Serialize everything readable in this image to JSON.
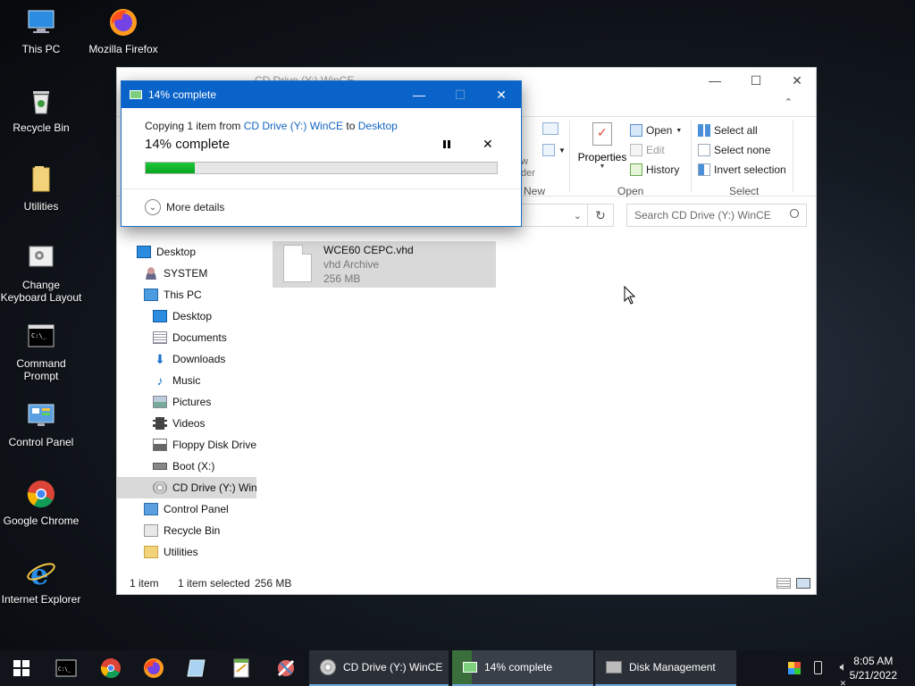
{
  "desktop": {
    "icons": [
      {
        "label": "This PC"
      },
      {
        "label": "Mozilla Firefox"
      },
      {
        "label": "Recycle Bin"
      },
      {
        "label": "Utilities"
      },
      {
        "label": "Change Keyboard Layout"
      },
      {
        "label": "Command Prompt"
      },
      {
        "label": "Control Panel"
      },
      {
        "label": "Google Chrome"
      },
      {
        "label": "Internet Explorer"
      }
    ]
  },
  "explorer": {
    "title": "CD Drive (Y:) WinCE",
    "ribbon": {
      "new_group_partial": "w\nder",
      "new_label": "New",
      "properties_label": "Properties",
      "open_label": "Open",
      "edit_label": "Edit",
      "history_label": "History",
      "open_group_label": "Open",
      "select_all_label": "Select all",
      "select_none_label": "Select none",
      "invert_selection_label": "Invert selection",
      "select_group_label": "Select"
    },
    "search": {
      "placeholder": "Search CD Drive (Y:) WinCE"
    },
    "nav": [
      {
        "label": "Desktop"
      },
      {
        "label": "SYSTEM"
      },
      {
        "label": "This PC"
      },
      {
        "label": "Desktop"
      },
      {
        "label": "Documents"
      },
      {
        "label": "Downloads"
      },
      {
        "label": "Music"
      },
      {
        "label": "Pictures"
      },
      {
        "label": "Videos"
      },
      {
        "label": "Floppy Disk Drive"
      },
      {
        "label": "Boot (X:)"
      },
      {
        "label": "CD Drive (Y:) WinCE"
      },
      {
        "label": "Control Panel"
      },
      {
        "label": "Recycle Bin"
      },
      {
        "label": "Utilities"
      }
    ],
    "file": {
      "name": "WCE60 CEPC.vhd",
      "type": "vhd Archive",
      "size": "256 MB"
    },
    "status": {
      "count": "1 item",
      "selected": "1 item selected",
      "size": "256 MB"
    }
  },
  "copy_dialog": {
    "title": "14% complete",
    "line_prefix": "Copying 1 item from",
    "source": "CD Drive (Y:) WinCE",
    "to_word": "to",
    "destination": "Desktop",
    "progress_text": "14% complete",
    "progress_percent": 14,
    "more_details": "More details"
  },
  "taskbar": {
    "tasks": [
      {
        "label": "CD Drive (Y:) WinCE"
      },
      {
        "label": "14% complete"
      },
      {
        "label": "Disk Management"
      }
    ],
    "time": "8:05 AM",
    "date": "5/21/2022"
  },
  "colors": {
    "accent": "#0a63c8",
    "progress": "#16b82e",
    "link": "#1565c0"
  }
}
